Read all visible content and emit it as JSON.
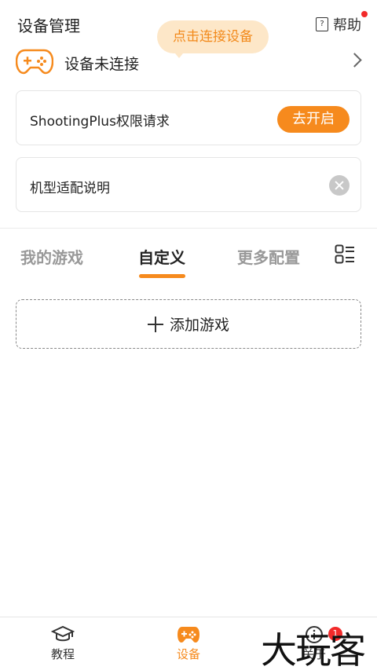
{
  "header": {
    "title": "设备管理",
    "help_label": "帮助",
    "help_icon_glyph": "?"
  },
  "tooltip": {
    "text": "点击连接设备"
  },
  "device": {
    "status": "设备未连接"
  },
  "cards": {
    "permission": {
      "label": "ShootingPlus权限请求",
      "button": "去开启"
    },
    "adapt": {
      "label": "机型适配说明"
    }
  },
  "tabs": [
    {
      "label": "我的游戏",
      "active": false
    },
    {
      "label": "自定义",
      "active": true
    },
    {
      "label": "更多配置",
      "active": false
    }
  ],
  "add_game": {
    "label": "添加游戏"
  },
  "bottom_nav": {
    "tutorial": "教程",
    "device": "设备",
    "about": "关于",
    "about_badge": "1"
  },
  "watermark": {
    "text": "大玩客"
  },
  "colors": {
    "accent": "#f68a1d",
    "tooltip_bg": "#fde7c8",
    "badge": "#f22a2a"
  }
}
